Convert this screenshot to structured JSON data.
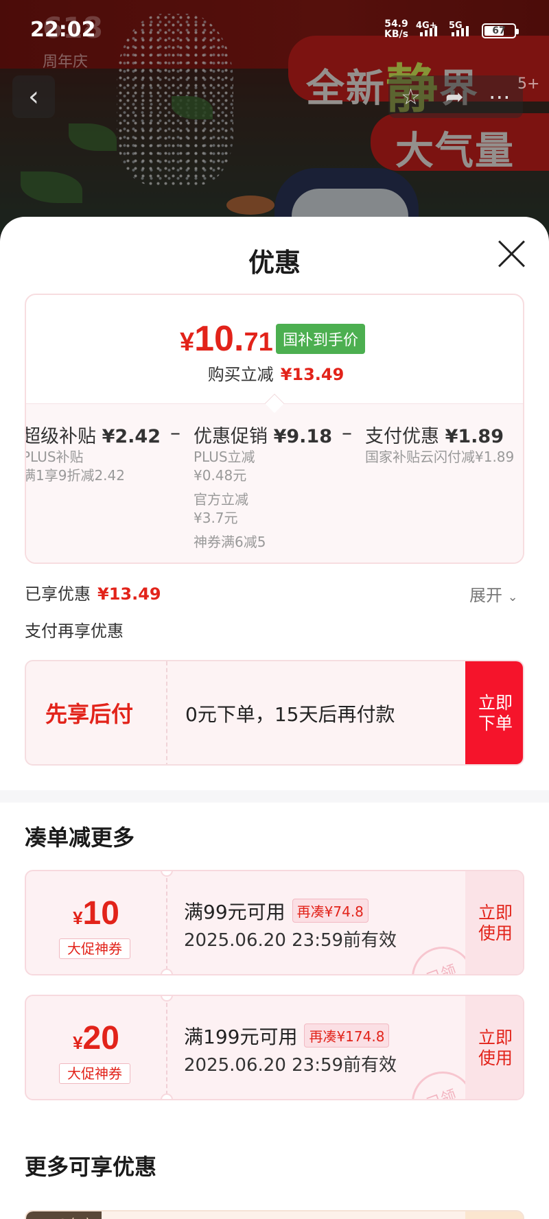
{
  "status_bar": {
    "time": "22:02",
    "net_speed": "54.9",
    "net_unit": "KB/s",
    "sim1": "4G+",
    "sim2": "5G",
    "battery": "67"
  },
  "banner": {
    "logo": "618",
    "logo_sub": "周年庆",
    "promo_line1_a": "全新",
    "promo_line1_b": "静",
    "promo_line1_c": "界",
    "promo_line2": "大气量",
    "media_count": "5+"
  },
  "sheet": {
    "title": "优惠",
    "price": {
      "currency": "¥",
      "integer": "10.",
      "decimal": "71",
      "tag": "国补到手价",
      "instant_label": "购买立减",
      "instant_amount": "¥13.49"
    },
    "breakdown": [
      {
        "label": "超级补贴",
        "amount": "¥2.42",
        "details": [
          "PLUS补贴",
          "满1享9折减2.42"
        ]
      },
      {
        "label": "优惠促销",
        "amount": "¥9.18",
        "details": [
          "PLUS立减",
          "¥0.48元",
          "官方立减",
          "¥3.7元",
          "神券满6减5"
        ]
      },
      {
        "label": "支付优惠",
        "amount": "¥1.89",
        "details": [
          "国家补贴云闪付减¥1.89"
        ]
      }
    ],
    "operator": "–",
    "enjoyed_label": "已享优惠",
    "enjoyed_amount": "¥13.49",
    "expand_label": "展开",
    "pay_more_label": "支付再享优惠",
    "bnpl": {
      "title": "先享后付",
      "desc": "0元下单，15天后再付款",
      "button_line1": "立即",
      "button_line2": "下单"
    },
    "bundle_title": "凑单减更多",
    "coupons": [
      {
        "currency": "¥",
        "amount": "10",
        "tag": "大促神券",
        "condition": "满99元可用",
        "extra": "再凑¥74.8",
        "validity": "2025.06.20 23:59前有效",
        "button_line1": "立即",
        "button_line2": "使用",
        "stamp": "已领"
      },
      {
        "currency": "¥",
        "amount": "20",
        "tag": "大促神券",
        "condition": "满199元可用",
        "extra": "再凑¥174.8",
        "validity": "2025.06.20 23:59前有效",
        "button_line1": "立即",
        "button_line2": "使用",
        "stamp": "已领"
      }
    ],
    "more_title": "更多可享优惠",
    "plus_tag": "PLUS专享"
  },
  "colors": {
    "accent_red": "#e2231a",
    "button_red": "#f5142b",
    "tag_green": "#4caf50"
  }
}
